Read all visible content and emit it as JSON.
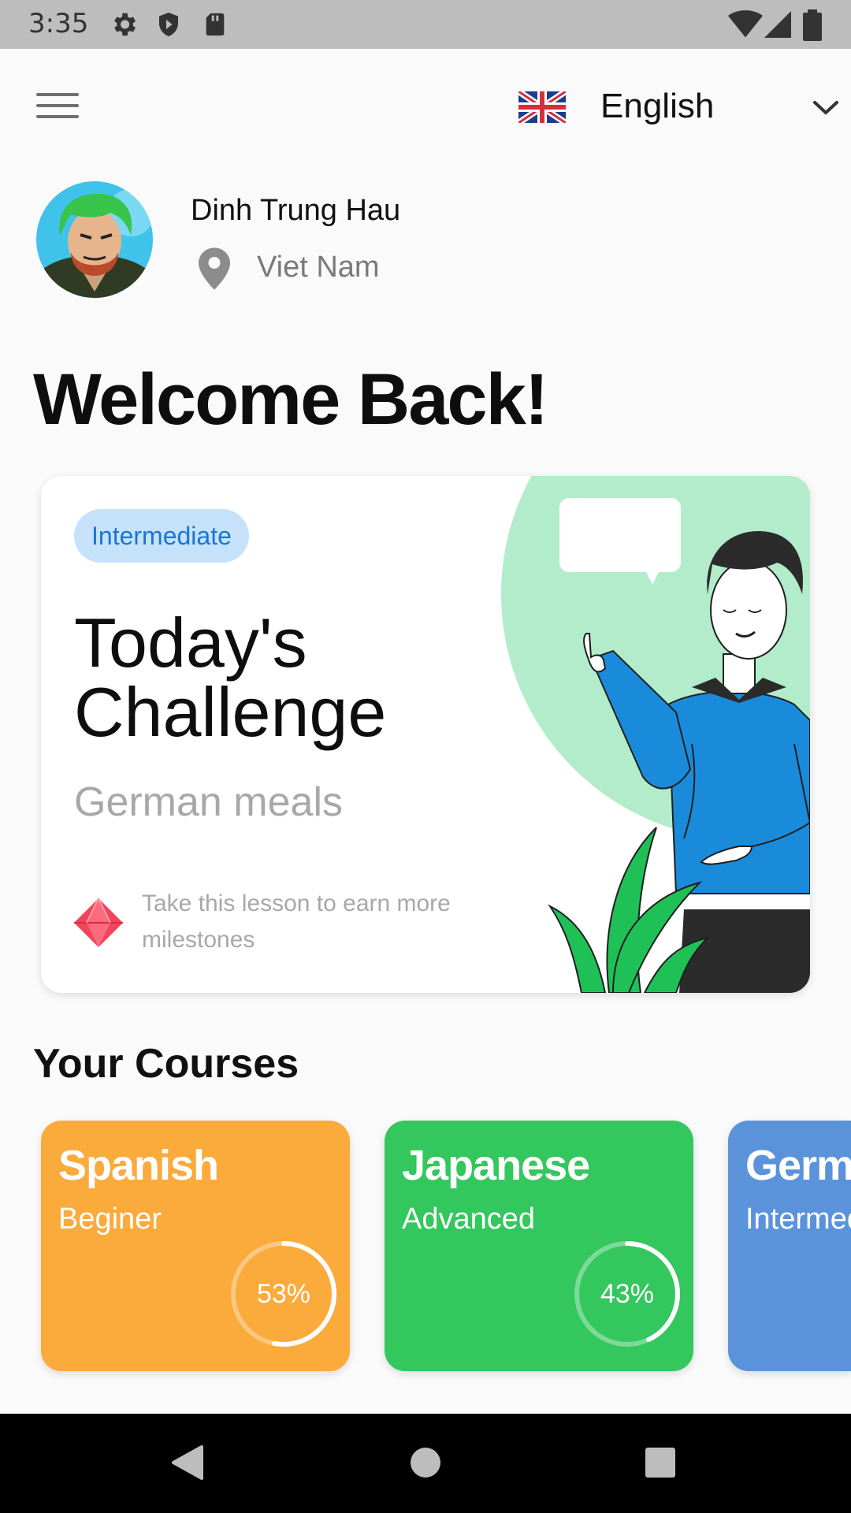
{
  "status_bar": {
    "time": "3:35"
  },
  "header": {
    "language": "English"
  },
  "profile": {
    "name": "Dinh Trung Hau",
    "country": "Viet Nam"
  },
  "welcome": "Welcome Back!",
  "challenge": {
    "level": "Intermediate",
    "title_line1": "Today's",
    "title_line2": "Challenge",
    "topic": "German meals",
    "reward_text": "Take this lesson to earn more milestones"
  },
  "courses_title": "Your Courses",
  "courses": [
    {
      "name": "Spanish",
      "level": "Beginer",
      "progress_label": "53%",
      "progress": 0.53,
      "color": "#fbaa3c"
    },
    {
      "name": "Japanese",
      "level": "Advanced",
      "progress_label": "43%",
      "progress": 0.43,
      "color": "#33c75e"
    },
    {
      "name": "German",
      "level": "Intermediate",
      "progress_label": "",
      "progress": 0,
      "color": "#5b93db"
    }
  ],
  "icons": {
    "menu": "hamburger-menu-icon",
    "flag": "uk-flag-icon",
    "dropdown": "chevron-down-icon",
    "location": "location-pin-icon",
    "reward": "gem-icon"
  },
  "colors": {
    "pill_bg": "#c6e2fb",
    "pill_text": "#1976d2",
    "illustration_circle": "#b2ecca"
  }
}
